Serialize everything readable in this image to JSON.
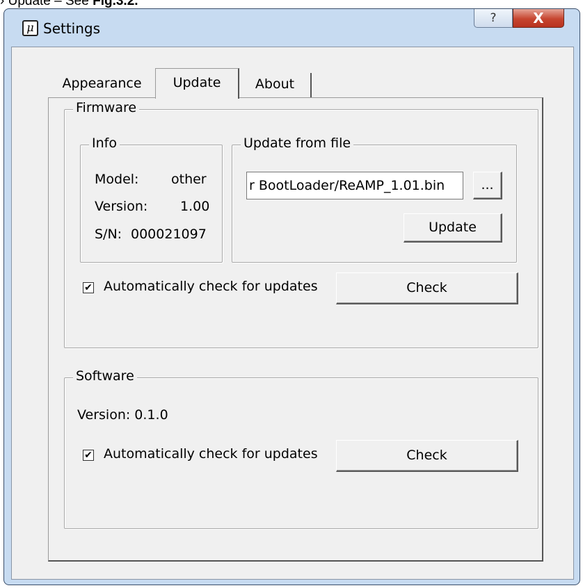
{
  "caption": {
    "prefix": "› Update – See ",
    "bold": "Fig.3.2."
  },
  "window": {
    "title": "Settings",
    "app_icon_glyph": "μ",
    "help_glyph": "?",
    "close_glyph": "X"
  },
  "tabs": [
    {
      "label": "Appearance",
      "selected": false
    },
    {
      "label": "Update",
      "selected": true
    },
    {
      "label": "About",
      "selected": false
    }
  ],
  "firmware": {
    "group_label": "Firmware",
    "info": {
      "group_label": "Info",
      "model_label": "Model:",
      "model_value": "other",
      "version_label": "Version:",
      "version_value": "1.00",
      "sn_label": "S/N:",
      "sn_value": "000021097"
    },
    "update_from_file": {
      "group_label": "Update from file",
      "file_value": "r BootLoader/ReAMP_1.01.bin",
      "browse_label": "...",
      "update_button": "Update"
    },
    "auto_check_label": "Automatically check for updates",
    "auto_check_checked": true,
    "check_button": "Check"
  },
  "software": {
    "group_label": "Software",
    "version_text": "Version:  0.1.0",
    "auto_check_label": "Automatically check for updates",
    "auto_check_checked": true,
    "check_button": "Check"
  },
  "colors": {
    "frame": "#c7dbf1",
    "client_bg": "#f0f0f0",
    "close_button": "#c6452f"
  }
}
